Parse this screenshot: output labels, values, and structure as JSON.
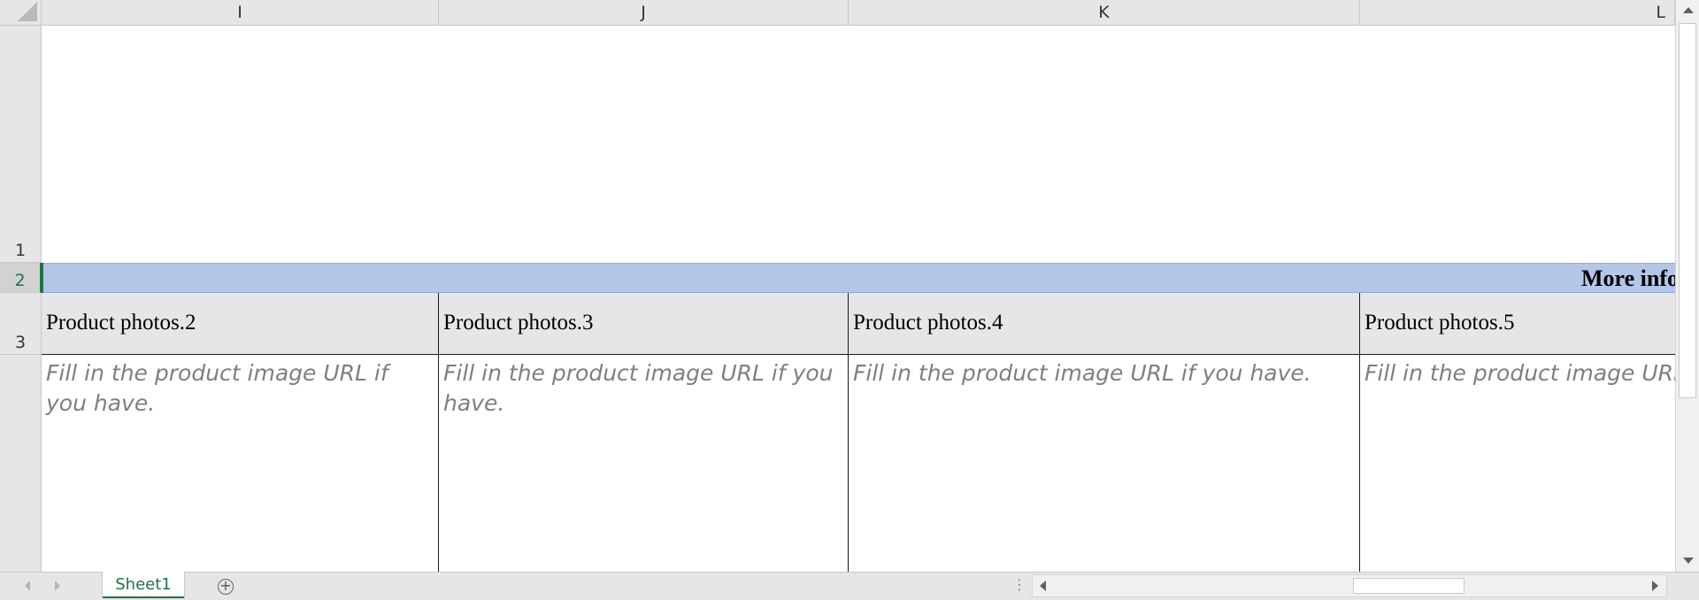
{
  "columns": [
    "I",
    "J",
    "K",
    "L"
  ],
  "rows": [
    "1",
    "2",
    "3"
  ],
  "row2_text": "More info",
  "headers": [
    "Product photos.2",
    "Product photos.3",
    "Product photos.4",
    "Product photos.5"
  ],
  "hints": [
    "Fill in the product image URL if you have.",
    "Fill in the product image URL if you have.",
    "Fill in the product image URL if you have.",
    "Fill in the product image URL if you have."
  ],
  "sheet_tab": "Sheet1",
  "add_sheet_glyph": "+",
  "colors": {
    "accent": "#217346",
    "row2_fill": "#b4c6e7",
    "header_fill": "#e6e6e6",
    "hint_text": "#7f7f7f"
  },
  "icons": [
    "select-all-icon",
    "scroll-up-icon",
    "scroll-down-icon",
    "scroll-left-icon",
    "scroll-right-icon",
    "add-sheet-icon",
    "sheet-nav-prev-icon",
    "sheet-nav-next-icon"
  ]
}
